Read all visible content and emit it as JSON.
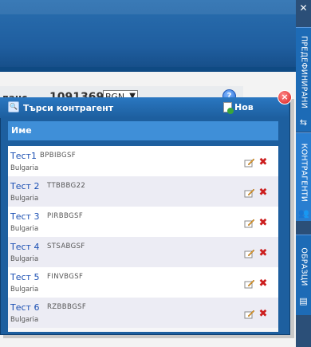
{
  "balance": {
    "label": "ланс",
    "value": "1091369.34",
    "currency": "BGN"
  },
  "right_tabs": [
    {
      "label": "ПРЕДЕФИНИРАНИ"
    },
    {
      "label": "КОНТРАГЕНТИ"
    },
    {
      "label": "ОБРАЗЦИ"
    }
  ],
  "panel": {
    "title": "Търси контрагент",
    "new_label": "Нов",
    "column_header": "Име"
  },
  "contractors": [
    {
      "name": "Тест1",
      "code": "BPBIBGSF",
      "country": "Bulgaria"
    },
    {
      "name": "Тест 2",
      "code": "TTBBBG22",
      "country": "Bulgaria"
    },
    {
      "name": "Тест 3",
      "code": "PIRBBGSF",
      "country": "Bulgaria"
    },
    {
      "name": "Тест 4",
      "code": "STSABGSF",
      "country": "Bulgaria"
    },
    {
      "name": "Тест 5",
      "code": "FINVBGSF",
      "country": "Bulgaria"
    },
    {
      "name": "Тест 6",
      "code": "RZBBBGSF",
      "country": "Bulgaria"
    }
  ],
  "colors": {
    "panel_blue": "#1d5f9f",
    "header_blue": "#3f8fd8",
    "link_blue": "#1a4fb3",
    "delete_red": "#cc1d1d"
  },
  "icons": [
    "search-icon",
    "new-contact-icon",
    "close-icon",
    "help-icon",
    "edit-icon",
    "delete-icon"
  ]
}
